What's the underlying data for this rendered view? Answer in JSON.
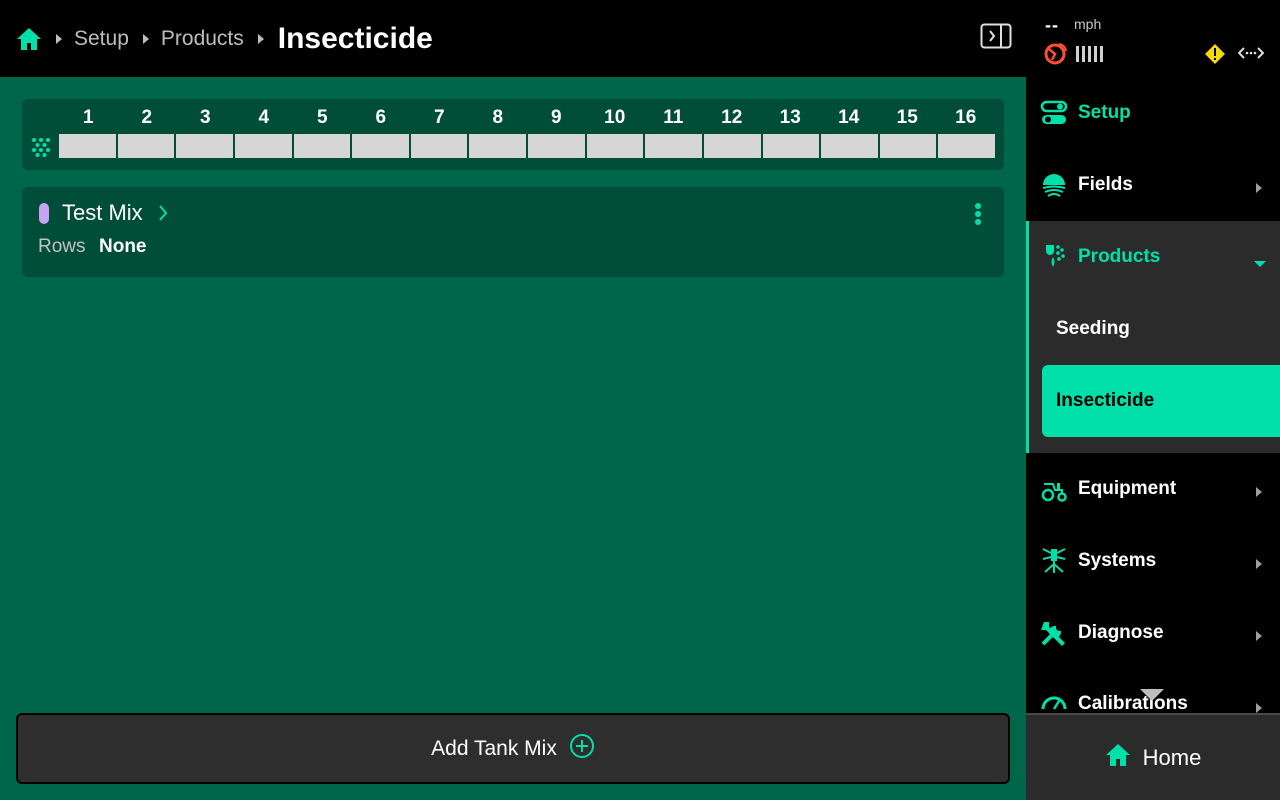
{
  "breadcrumb": {
    "items": [
      "Setup",
      "Products"
    ],
    "current": "Insecticide"
  },
  "status": {
    "speed_value": "--",
    "speed_unit": "mph"
  },
  "rows": {
    "numbers": [
      "1",
      "2",
      "3",
      "4",
      "5",
      "6",
      "7",
      "8",
      "9",
      "10",
      "11",
      "12",
      "13",
      "14",
      "15",
      "16"
    ]
  },
  "tank_mix": {
    "name": "Test Mix",
    "rows_label": "Rows",
    "rows_value": "None",
    "color": "#c9a3f5"
  },
  "add_button": {
    "label": "Add Tank Mix"
  },
  "sidebar": {
    "setup": "Setup",
    "fields": "Fields",
    "products": "Products",
    "products_sub": [
      "Seeding",
      "Insecticide"
    ],
    "equipment": "Equipment",
    "systems": "Systems",
    "diagnose": "Diagnose",
    "calibrations": "Calibrations",
    "home": "Home"
  },
  "colors": {
    "accent": "#00e0a8",
    "main_bg": "#00664a",
    "card_bg": "#004d38",
    "warning": "#f5d90a",
    "gps_alert": "#ff4d2e"
  }
}
